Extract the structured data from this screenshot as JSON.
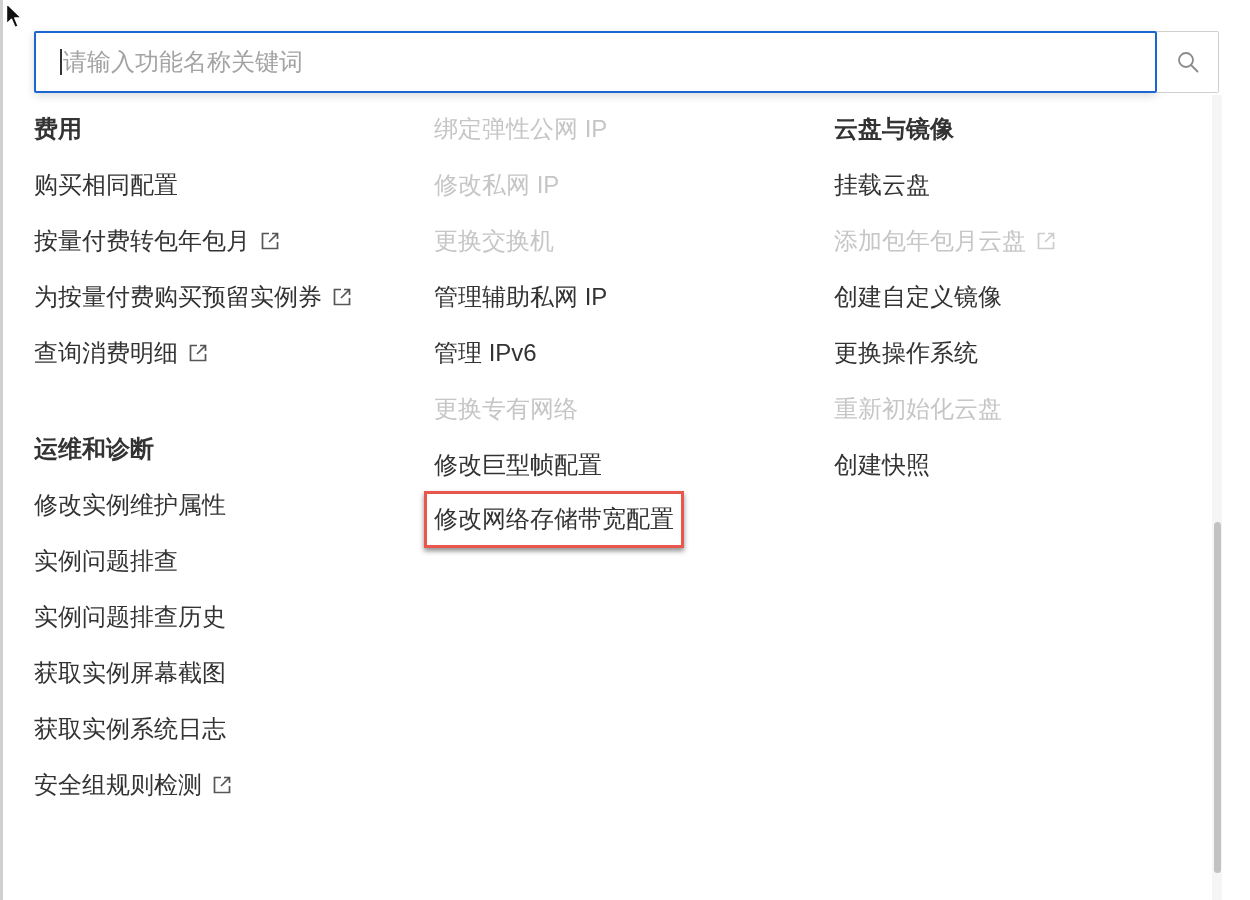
{
  "search": {
    "placeholder": "请输入功能名称关键词",
    "focused": true
  },
  "columns": [
    {
      "groups": [
        {
          "heading": "费用",
          "items": [
            {
              "label": "购买相同配置",
              "disabled": false,
              "external_link": false,
              "highlighted": false
            },
            {
              "label": "按量付费转包年包月",
              "disabled": false,
              "external_link": true,
              "highlighted": false
            },
            {
              "label": "为按量付费购买预留实例券",
              "disabled": false,
              "external_link": true,
              "highlighted": false
            },
            {
              "label": "查询消费明细",
              "disabled": false,
              "external_link": true,
              "highlighted": false
            }
          ]
        },
        {
          "heading": "运维和诊断",
          "items": [
            {
              "label": "修改实例维护属性",
              "disabled": false,
              "external_link": false,
              "highlighted": false
            },
            {
              "label": "实例问题排查",
              "disabled": false,
              "external_link": false,
              "highlighted": false
            },
            {
              "label": "实例问题排查历史",
              "disabled": false,
              "external_link": false,
              "highlighted": false
            },
            {
              "label": "获取实例屏幕截图",
              "disabled": false,
              "external_link": false,
              "highlighted": false
            },
            {
              "label": "获取实例系统日志",
              "disabled": false,
              "external_link": false,
              "highlighted": false
            },
            {
              "label": "安全组规则检测",
              "disabled": false,
              "external_link": true,
              "highlighted": false
            }
          ]
        }
      ]
    },
    {
      "groups": [
        {
          "items": [
            {
              "label": "绑定弹性公网 IP",
              "disabled": true,
              "external_link": false,
              "highlighted": false
            },
            {
              "label": "修改私网 IP",
              "disabled": true,
              "external_link": false,
              "highlighted": false
            },
            {
              "label": "更换交换机",
              "disabled": true,
              "external_link": false,
              "highlighted": false
            },
            {
              "label": "管理辅助私网 IP",
              "disabled": false,
              "external_link": false,
              "highlighted": false
            },
            {
              "label": "管理 IPv6",
              "disabled": false,
              "external_link": false,
              "highlighted": false
            },
            {
              "label": "更换专有网络",
              "disabled": true,
              "external_link": false,
              "highlighted": false
            },
            {
              "label": "修改巨型帧配置",
              "disabled": false,
              "external_link": false,
              "highlighted": false
            },
            {
              "label": "修改网络存储带宽配置",
              "disabled": false,
              "external_link": false,
              "highlighted": true
            }
          ]
        }
      ]
    },
    {
      "groups": [
        {
          "heading": "云盘与镜像",
          "items": [
            {
              "label": "挂载云盘",
              "disabled": false,
              "external_link": false,
              "highlighted": false
            },
            {
              "label": "添加包年包月云盘",
              "disabled": true,
              "external_link": true,
              "highlighted": false
            },
            {
              "label": "创建自定义镜像",
              "disabled": false,
              "external_link": false,
              "highlighted": false
            },
            {
              "label": "更换操作系统",
              "disabled": false,
              "external_link": false,
              "highlighted": false
            },
            {
              "label": "重新初始化云盘",
              "disabled": true,
              "external_link": false,
              "highlighted": false
            },
            {
              "label": "创建快照",
              "disabled": false,
              "external_link": false,
              "highlighted": false
            }
          ]
        }
      ]
    }
  ]
}
